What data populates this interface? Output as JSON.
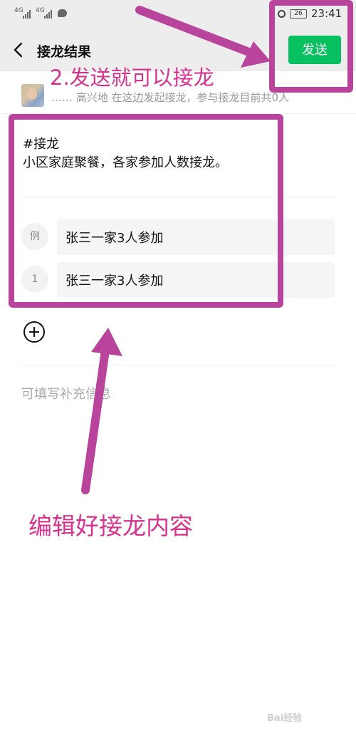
{
  "status_bar": {
    "net_left": "4G",
    "net_right": "4G",
    "battery_level": "26",
    "time": "23:41"
  },
  "title_bar": {
    "title": "接龙结果",
    "send_label": "发送"
  },
  "initiator": {
    "text": "…… 高兴地 在这边发起接龙，参与接龙目前共0人"
  },
  "solitaire": {
    "text": "#接龙\n小区家庭聚餐，各家参加人数接龙。",
    "example_badge": "例",
    "example_value": "张三一家3人参加",
    "entries": [
      {
        "badge": "1",
        "value": "张三一家3人参加"
      }
    ]
  },
  "supplement": {
    "placeholder": "可填写补充信息"
  },
  "annotations": {
    "send_hint": "2.发送就可以接龙",
    "edit_hint": "编辑好接龙内容",
    "color": "#d6338f",
    "box_color": "#b8449c"
  },
  "colors": {
    "accent": "#07c160",
    "bar_bg": "#ededed"
  },
  "watermark": {
    "text": "Bai经验"
  }
}
